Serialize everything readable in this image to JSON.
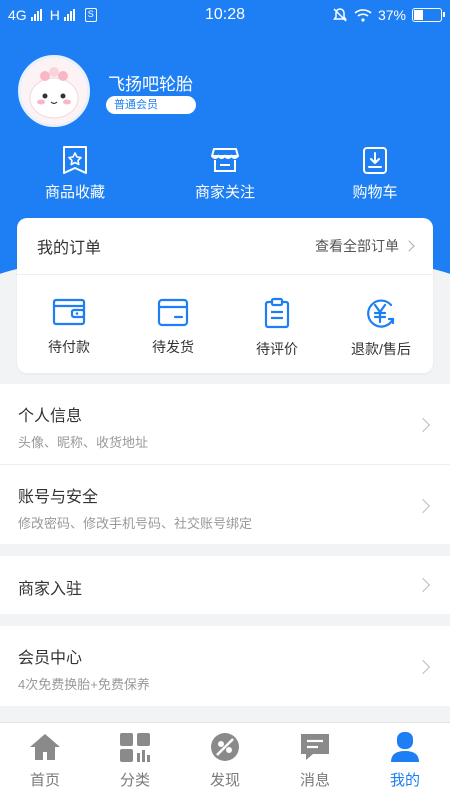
{
  "status_bar": {
    "network1": "4G",
    "network2": "H",
    "time": "10:28",
    "battery": "37%"
  },
  "profile": {
    "username": "飞扬吧轮胎",
    "member_level": "普通会员"
  },
  "quick_links": [
    {
      "label": "商品收藏",
      "icon": "star-bag-icon"
    },
    {
      "label": "商家关注",
      "icon": "store-icon"
    },
    {
      "label": "购物车",
      "icon": "cart-icon"
    }
  ],
  "orders": {
    "title": "我的订单",
    "view_all": "查看全部订单",
    "items": [
      {
        "label": "待付款",
        "icon": "wallet-icon"
      },
      {
        "label": "待发货",
        "icon": "box-icon"
      },
      {
        "label": "待评价",
        "icon": "clipboard-icon"
      },
      {
        "label": "退款/售后",
        "icon": "yen-refund-icon"
      }
    ]
  },
  "menu": {
    "personal_info": {
      "title": "个人信息",
      "subtitle": "头像、昵称、收货地址"
    },
    "account_security": {
      "title": "账号与安全",
      "subtitle": "修改密码、修改手机号码、社交账号绑定"
    },
    "merchant_join": {
      "title": "商家入驻"
    },
    "member_center": {
      "title": "会员中心",
      "subtitle": "4次免费换胎+免费保养"
    }
  },
  "tabs": [
    {
      "label": "首页",
      "icon": "home-icon"
    },
    {
      "label": "分类",
      "icon": "category-icon"
    },
    {
      "label": "发现",
      "icon": "discover-icon"
    },
    {
      "label": "消息",
      "icon": "message-icon"
    },
    {
      "label": "我的",
      "icon": "profile-icon"
    }
  ],
  "colors": {
    "primary": "#1d7ff3",
    "background": "#f2f3f5"
  }
}
